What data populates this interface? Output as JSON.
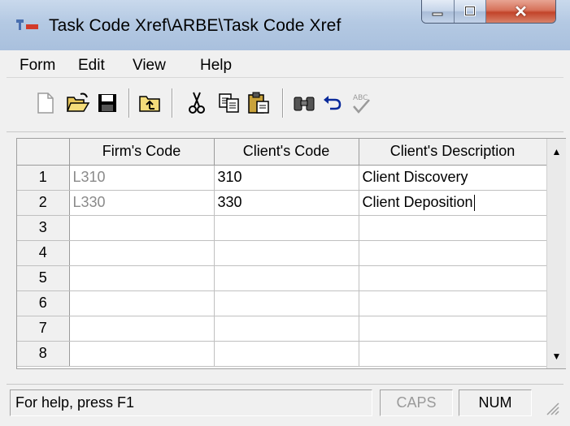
{
  "window": {
    "title": "Task Code Xref\\ARBE\\Task Code Xref",
    "caption_buttons": [
      "minimize",
      "maximize",
      "close"
    ]
  },
  "menubar": {
    "items": [
      {
        "label": "Form"
      },
      {
        "label": "Edit"
      },
      {
        "label": "View"
      },
      {
        "label": "Help"
      }
    ]
  },
  "toolbar": {
    "buttons": [
      {
        "icon": "new-document-icon",
        "enabled": false
      },
      {
        "icon": "open-folder-icon",
        "enabled": true
      },
      {
        "icon": "save-disk-icon",
        "enabled": true
      },
      {
        "icon": "up-folder-icon",
        "enabled": true
      },
      {
        "icon": "cut-scissors-icon",
        "enabled": true
      },
      {
        "icon": "copy-icon",
        "enabled": true
      },
      {
        "icon": "paste-clipboard-icon",
        "enabled": true
      },
      {
        "icon": "find-binoculars-icon",
        "enabled": true
      },
      {
        "icon": "undo-arrow-icon",
        "enabled": true
      },
      {
        "icon": "spellcheck-icon",
        "enabled": false
      }
    ]
  },
  "grid": {
    "columns": [
      "Firm's Code",
      "Client's Code",
      "Client's Description"
    ],
    "rows": [
      {
        "num": "1",
        "firm": "L310",
        "client": "310",
        "desc": "Client Discovery"
      },
      {
        "num": "2",
        "firm": "L330",
        "client": "330",
        "desc": "Client Deposition"
      },
      {
        "num": "3",
        "firm": "",
        "client": "",
        "desc": ""
      },
      {
        "num": "4",
        "firm": "",
        "client": "",
        "desc": ""
      },
      {
        "num": "5",
        "firm": "",
        "client": "",
        "desc": ""
      },
      {
        "num": "6",
        "firm": "",
        "client": "",
        "desc": ""
      },
      {
        "num": "7",
        "firm": "",
        "client": "",
        "desc": ""
      },
      {
        "num": "8",
        "firm": "",
        "client": "",
        "desc": ""
      }
    ]
  },
  "statusbar": {
    "help": "For help, press F1",
    "caps": "CAPS",
    "num": "NUM"
  },
  "colors": {
    "firm_code_text": "#8a8a8a",
    "titlebar": "#b4c9e3",
    "close_button": "#c2442a"
  }
}
